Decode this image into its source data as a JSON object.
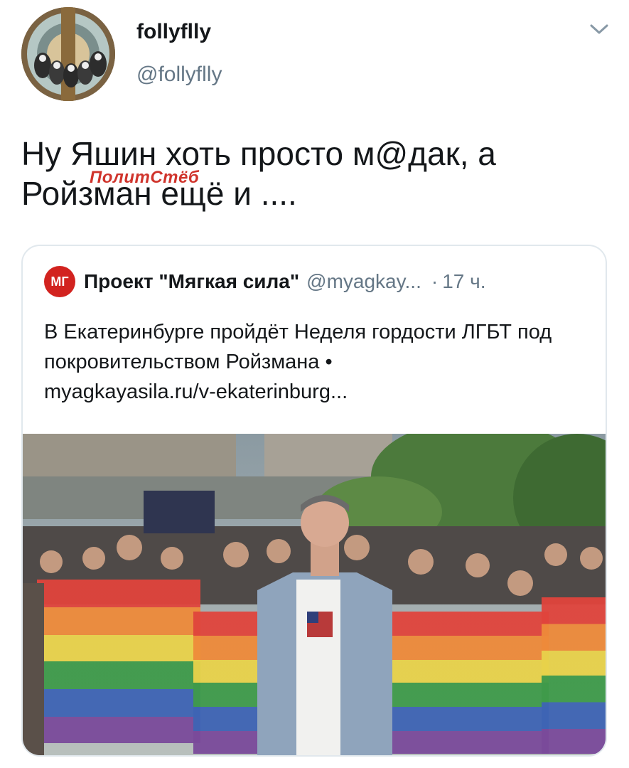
{
  "author": {
    "display_name": "follyflly",
    "handle": "@follyflly"
  },
  "tweet": {
    "text": "Ну Яшин хоть просто м@дак, а Ройзман ещё и ....",
    "watermark": "ПолитСтёб"
  },
  "quoted_tweet": {
    "avatar_text": "МГ",
    "name": "Проект \"Мягкая сила\"",
    "handle": "@myagkay...",
    "separator": "·",
    "time": "17 ч.",
    "text": "В Екатеринбурге пройдёт Неделя гордости ЛГБТ под покровительством Ройзмана •",
    "link": "myagkayasila.ru/v-ekaterinburg..."
  },
  "icons": {
    "menu": "chevron-down-icon"
  },
  "colors": {
    "text": "#14171a",
    "secondary": "#657786",
    "border": "#e1e8ed",
    "brand_red": "#d2231f",
    "watermark": "#d0342c"
  }
}
